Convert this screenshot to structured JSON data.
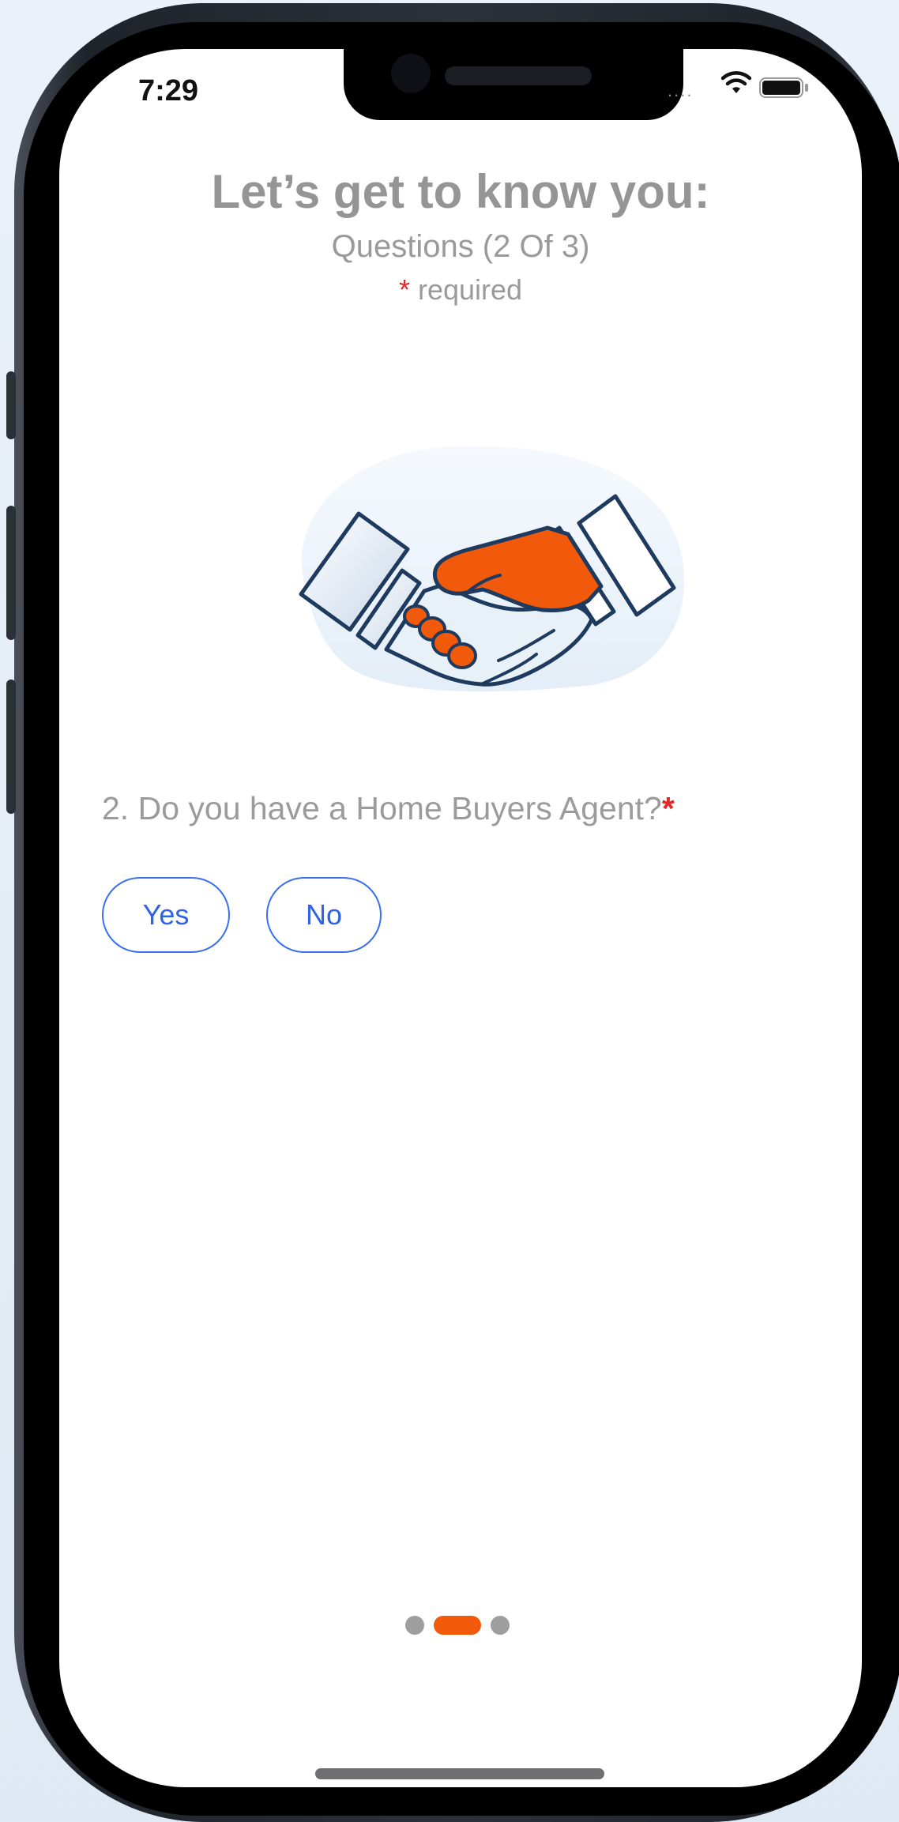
{
  "status_bar": {
    "time": "7:29",
    "signal": "....",
    "wifi_icon": "wifi-icon",
    "battery_icon": "battery-icon"
  },
  "header": {
    "title": "Let’s get to know you:",
    "subtitle": "Questions (2 Of 3)",
    "required_star": "*",
    "required_label": "required"
  },
  "illustration": {
    "icon": "handshake-icon",
    "accent_color": "#f05a0a",
    "outline_color": "#1e3a5f"
  },
  "question": {
    "text": "2. Do you have a Home Buyers Agent?",
    "required_star": "*"
  },
  "options": {
    "yes_label": "Yes",
    "no_label": "No"
  },
  "pager": {
    "current_page": 2,
    "total_pages": 3,
    "active_color": "#f05a0a"
  },
  "colors": {
    "button_accent": "#2f63e6",
    "required": "#e02a2a",
    "muted_text": "#9a9a9a"
  }
}
